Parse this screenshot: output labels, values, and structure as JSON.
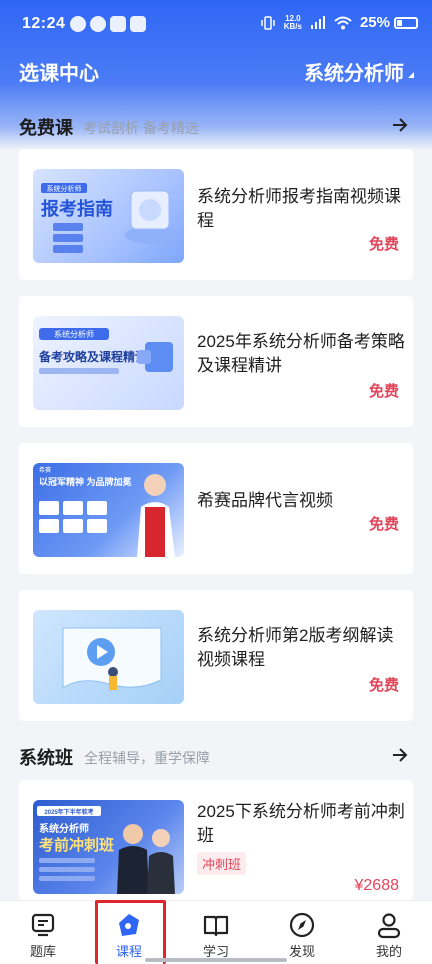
{
  "status_bar": {
    "time": "12:24",
    "net_speed": "12.0\nKB/s",
    "battery": "25%"
  },
  "header": {
    "title": "选课中心",
    "exam": "系统分析师"
  },
  "free_section": {
    "title": "免费课",
    "subtitle": "考试剖析 备考精选",
    "courses": [
      {
        "title": "系统分析师报考指南视频课程",
        "price": "免费",
        "thumb_text": "报考指南",
        "thumb_sub": "系统分析师"
      },
      {
        "title": "2025年系统分析师备考策略及课程精讲",
        "price": "免费",
        "thumb_text": "备考攻略及课程精讲",
        "thumb_sub": "系统分析师"
      },
      {
        "title": "希赛品牌代言视频",
        "price": "免费",
        "thumb_text": "以冠军精神 为品牌加冕",
        "thumb_sub": "希赛"
      },
      {
        "title": "系统分析师第2版考纲解读视频课程",
        "price": "免费",
        "thumb_text": "",
        "thumb_sub": ""
      }
    ]
  },
  "system_section": {
    "title": "系统班",
    "subtitle": "全程辅导，重学保障",
    "courses": [
      {
        "title": "2025下系统分析师考前冲刺班",
        "tag": "冲刺班",
        "price": "¥2688",
        "thumb_text": "考前冲刺班",
        "thumb_sub": "系统分析师",
        "thumb_badge": "2025年下半年软考"
      }
    ]
  },
  "bottom_nav": {
    "items": [
      {
        "label": "题库",
        "icon": "question-bank-icon"
      },
      {
        "label": "课程",
        "icon": "course-icon",
        "active": true
      },
      {
        "label": "学习",
        "icon": "book-icon"
      },
      {
        "label": "发现",
        "icon": "compass-icon"
      },
      {
        "label": "我的",
        "icon": "profile-icon"
      }
    ]
  },
  "colors": {
    "brand": "#2f66f5",
    "price": "#e2465a",
    "highlight": "#e0252d"
  }
}
